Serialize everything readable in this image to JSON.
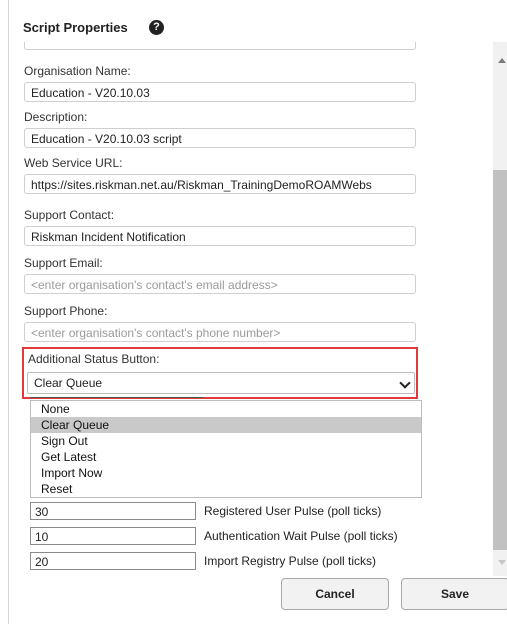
{
  "dialog": {
    "title": "Script Properties",
    "help_icon": "?"
  },
  "fields": {
    "organisation_name": {
      "label": "Organisation Name:",
      "value": "Education - V20.10.03"
    },
    "description": {
      "label": "Description:",
      "value": "Education - V20.10.03 script"
    },
    "web_service_url": {
      "label": "Web Service URL:",
      "value": "https://sites.riskman.net.au/Riskman_TrainingDemoROAMWebs"
    },
    "support_contact": {
      "label": "Support Contact:",
      "value": "Riskman Incident Notification"
    },
    "support_email": {
      "label": "Support Email:",
      "placeholder": "<enter organisation's contact's email address>"
    },
    "support_phone": {
      "label": "Support Phone:",
      "placeholder": "<enter organisation's contact's phone number>"
    },
    "additional_status_button": {
      "label": "Additional Status Button:",
      "selected": "Clear Queue"
    }
  },
  "dropdown_options": [
    "None",
    "Clear Queue",
    "Sign Out",
    "Get Latest",
    "Import Now",
    "Reset"
  ],
  "dropdown_selected_index": 1,
  "pulses": [
    {
      "value": "30",
      "label": "Registered User Pulse (poll ticks)"
    },
    {
      "value": "10",
      "label": "Authentication Wait Pulse (poll ticks)"
    },
    {
      "value": "20",
      "label": "Import Registry Pulse (poll ticks)"
    }
  ],
  "buttons": {
    "cancel": "Cancel",
    "save": "Save"
  },
  "colors": {
    "highlight": "#e03a3a",
    "option_selected_bg": "#c9c9c9"
  }
}
